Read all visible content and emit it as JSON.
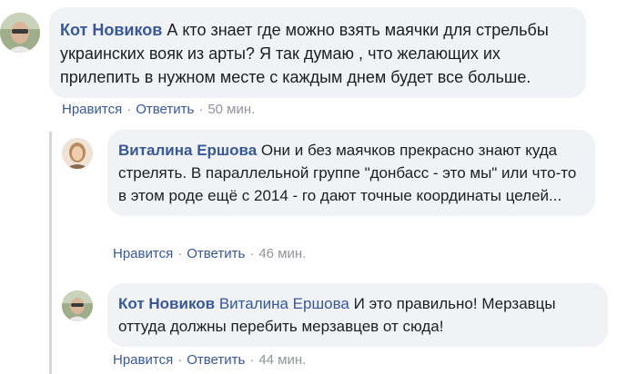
{
  "comments": [
    {
      "author": "Кот Новиков",
      "text": "А кто знает где можно взять маячки для стрельбы украинских вояк из арты? Я так думаю , что желающих их прилепить в нужном месте с каждым днем будет все больше.",
      "like_label": "Нравится",
      "reply_label": "Ответить",
      "time": "50 мин."
    },
    {
      "author": "Виталина Ершова",
      "text": "Они и без маячков прекрасно знают куда стрелять. В параллельной группе \"донбасс - это мы\" или что-то в этом роде ещё с 2014 - го дают точные координаты целей...",
      "like_label": "Нравится",
      "reply_label": "Ответить",
      "time": "46 мин."
    },
    {
      "author": "Кот Новиков",
      "mention": "Виталина Ершова",
      "text": "И это правильно! Мерзавцы оттуда должны перебить мерзавцев от сюда!",
      "like_label": "Нравится",
      "reply_label": "Ответить",
      "time": "44 мин."
    }
  ],
  "separator": "·",
  "colors": {
    "link": "#385898",
    "meta": "#90949c",
    "bubble": "#f0f2f5",
    "text": "#1c1e21"
  }
}
